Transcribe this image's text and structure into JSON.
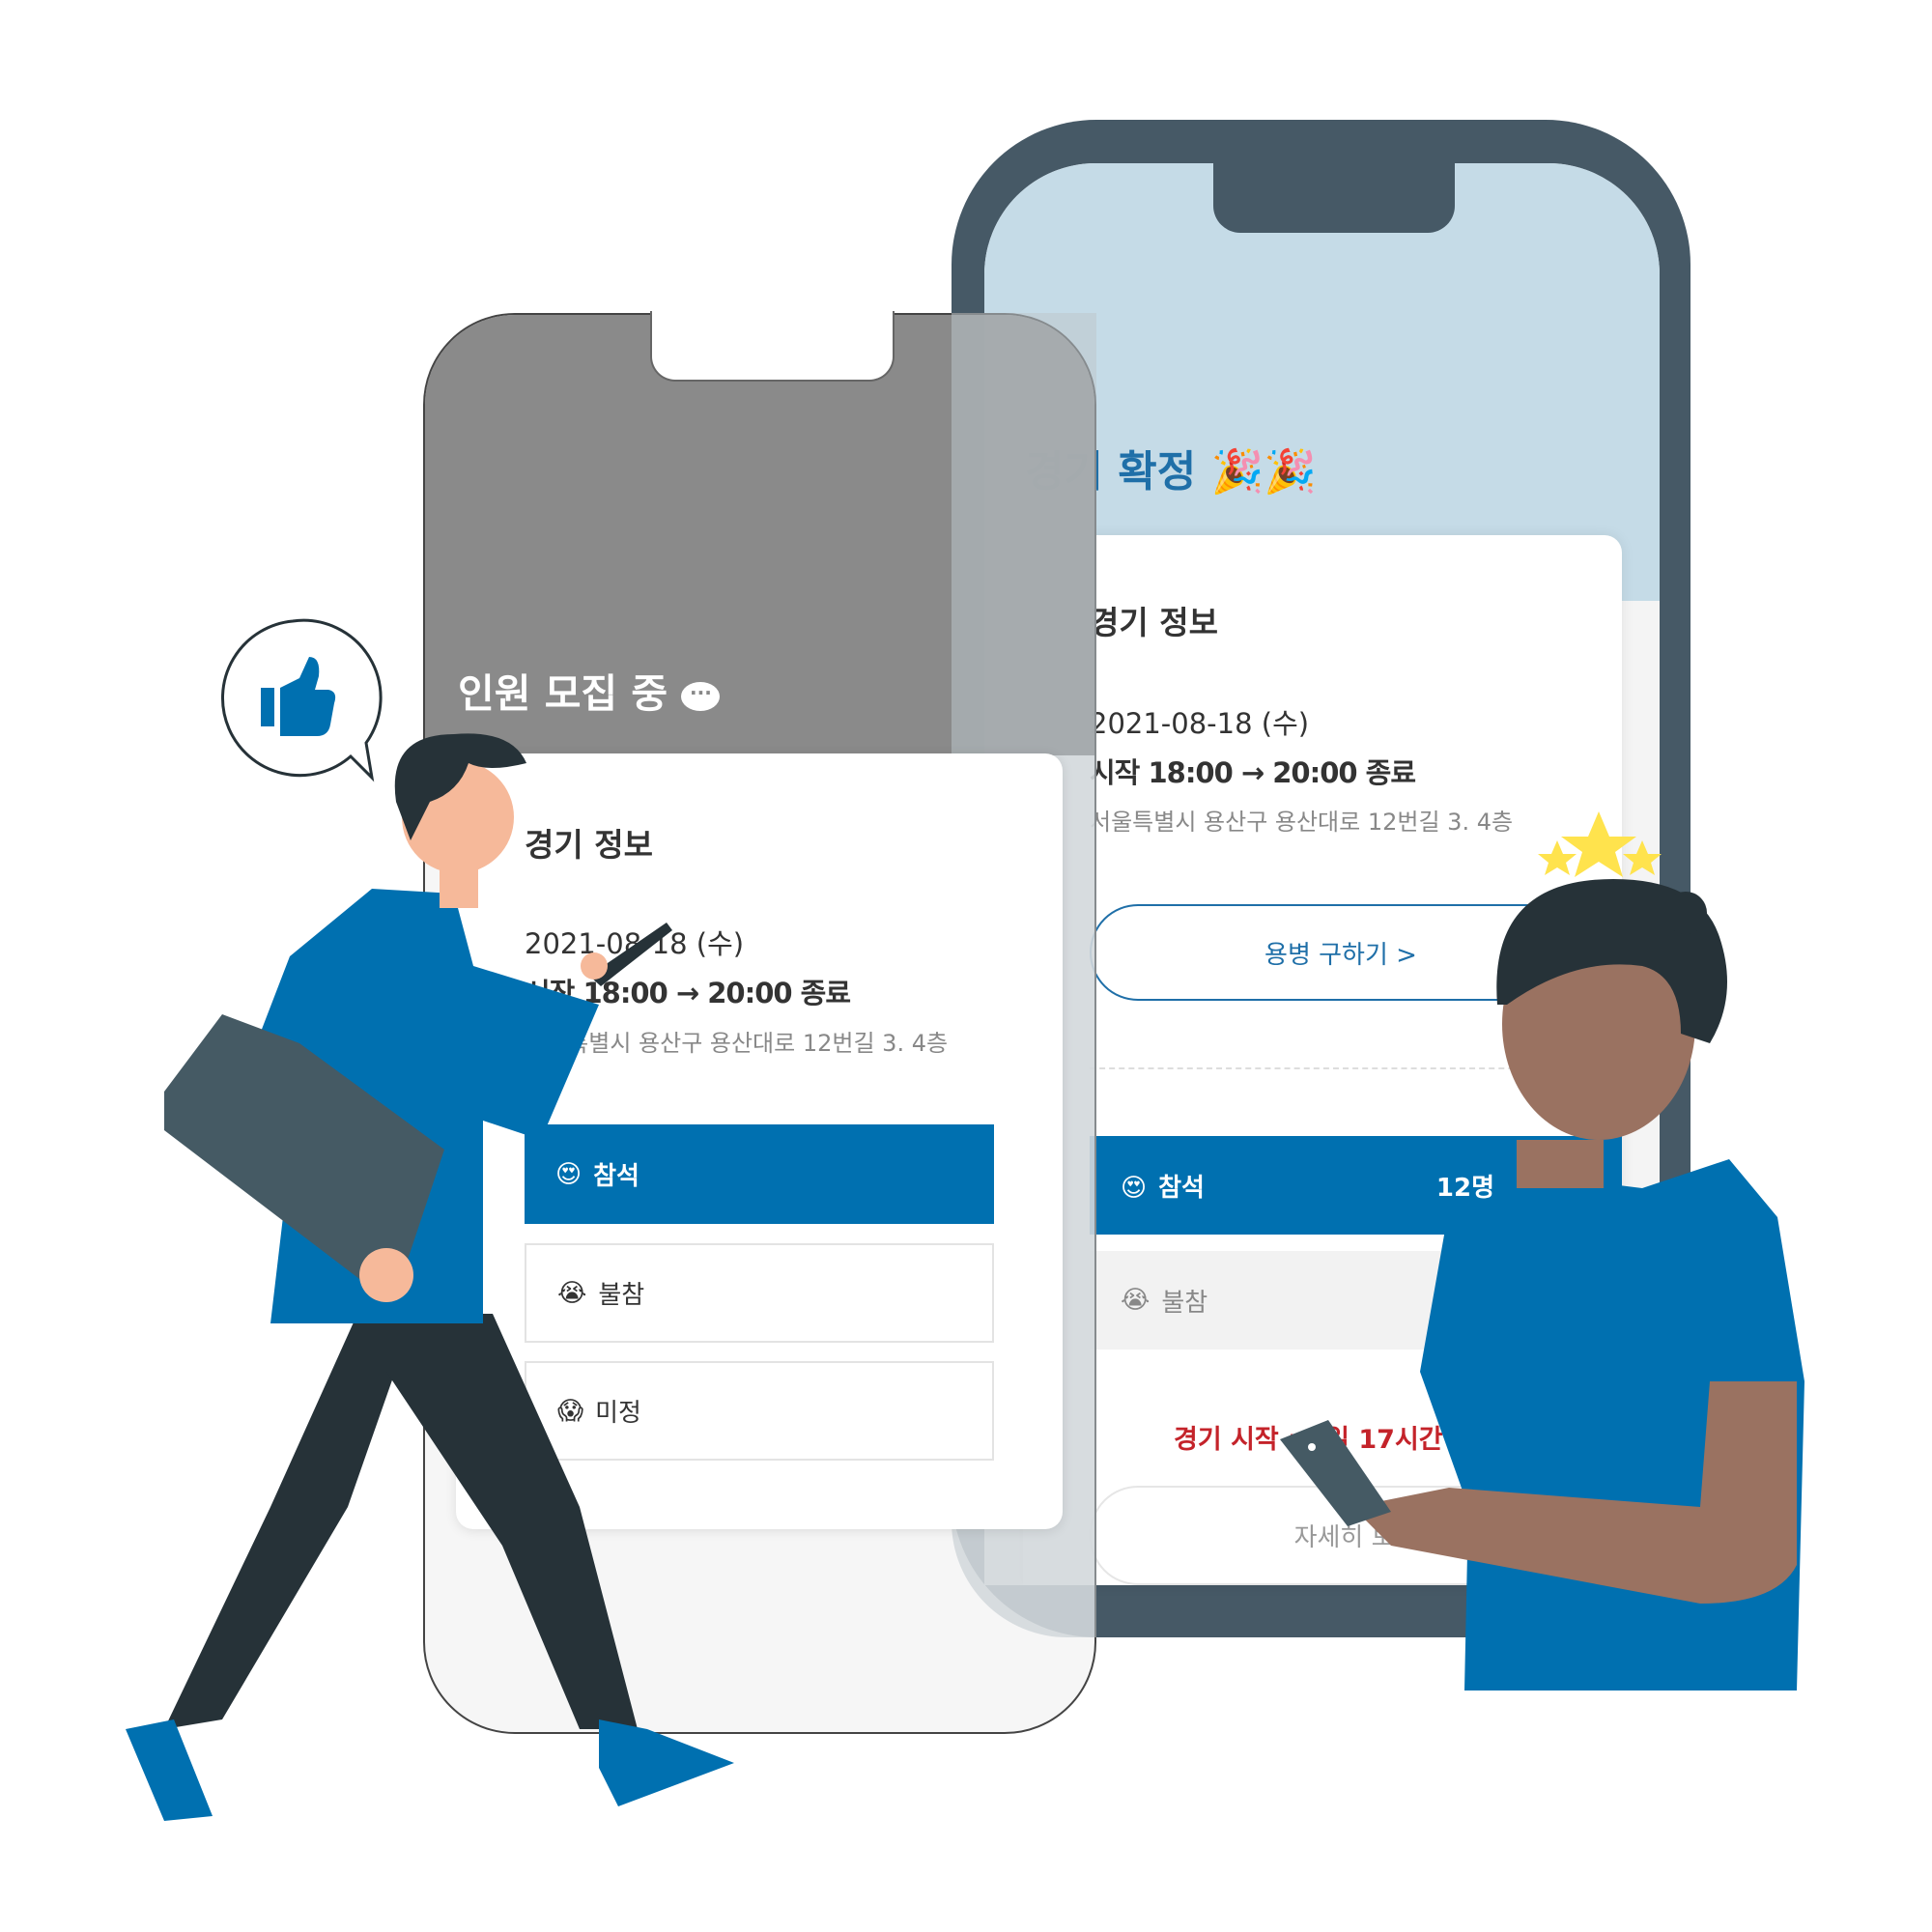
{
  "back_phone": {
    "title": "경기 확정",
    "title_emoji": "🎉🎉",
    "card_title": "경기 정보",
    "date": "2021-08-18 (수)",
    "time": "시작 18:00 → 20:00 종료",
    "address": "서울특별시 용산구 용산대로 12번길 3. 4층",
    "mercenary_button": "용병 구하기 >",
    "attend": {
      "emoji": "😍",
      "label": "참석",
      "count": "12명"
    },
    "absent": {
      "emoji": "😭",
      "label": "불참"
    },
    "countdown": "경기 시작 : 0일 17시간 32분",
    "detail_button": "자세히 보기"
  },
  "front_phone": {
    "title": "인원 모집 중",
    "title_icon": "speech-bubble-icon",
    "card_title": "경기 정보",
    "date": "2021-08-18 (수)",
    "time": "시작 18:00 → 20:00 종료",
    "address": "서울특별시 용산구 용산대로 12번길 3. 4층",
    "options": [
      {
        "emoji": "😍",
        "label": "참석"
      },
      {
        "emoji": "😭",
        "label": "불참"
      },
      {
        "emoji": "😱",
        "label": "미정"
      }
    ]
  },
  "colors": {
    "brand_blue": "#0070b0",
    "frame": "#465966",
    "header_blue": "#c5dbe7",
    "alert_red": "#c4232a",
    "skin_dark": "#9a7261",
    "star": "#ffe34d"
  }
}
